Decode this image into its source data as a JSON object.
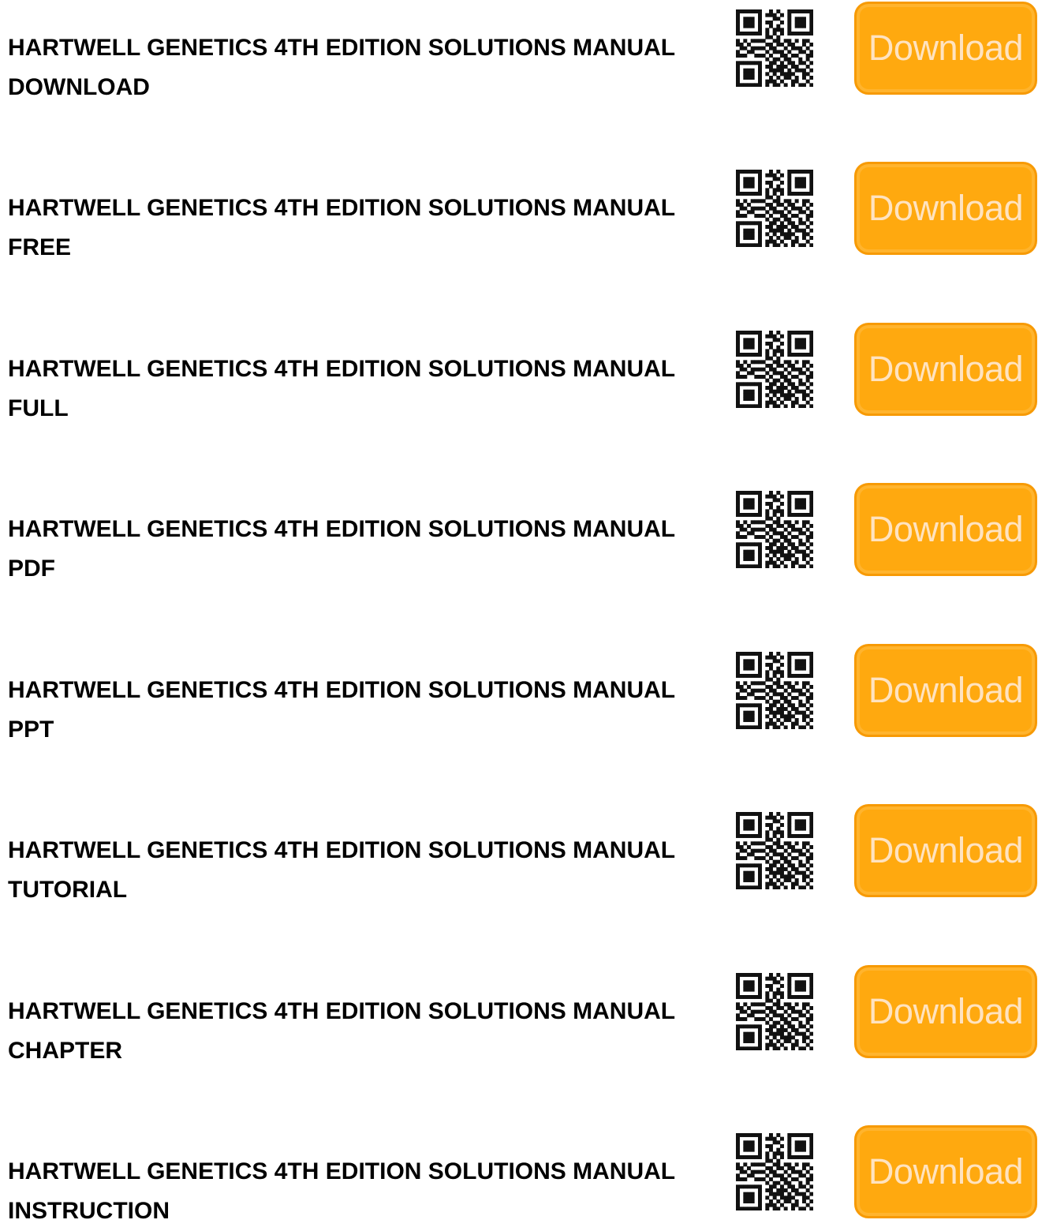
{
  "items": [
    {
      "line1": "HARTWELL GENETICS 4TH EDITION SOLUTIONS MANUAL",
      "line2": "DOWNLOAD",
      "button": "Download"
    },
    {
      "line1": "HARTWELL GENETICS 4TH EDITION SOLUTIONS MANUAL",
      "line2": "FREE",
      "button": "Download"
    },
    {
      "line1": "HARTWELL GENETICS 4TH EDITION SOLUTIONS MANUAL",
      "line2": "FULL",
      "button": "Download"
    },
    {
      "line1": "HARTWELL GENETICS 4TH EDITION SOLUTIONS MANUAL",
      "line2": "PDF",
      "button": "Download"
    },
    {
      "line1": "HARTWELL GENETICS 4TH EDITION SOLUTIONS MANUAL",
      "line2": "PPT",
      "button": "Download"
    },
    {
      "line1": "HARTWELL GENETICS 4TH EDITION SOLUTIONS MANUAL",
      "line2": "TUTORIAL",
      "button": "Download"
    },
    {
      "line1": "HARTWELL GENETICS 4TH EDITION SOLUTIONS MANUAL",
      "line2": "CHAPTER",
      "button": "Download"
    },
    {
      "line1": "HARTWELL GENETICS 4TH EDITION SOLUTIONS MANUAL",
      "line2": "INSTRUCTION",
      "button": "Download"
    }
  ],
  "icons": {
    "qr": "qr-code-icon"
  },
  "colors": {
    "button_bg": "#ffa90f",
    "button_border": "#f79a05",
    "button_text": "#ffe3c0",
    "title_text": "#000000"
  }
}
